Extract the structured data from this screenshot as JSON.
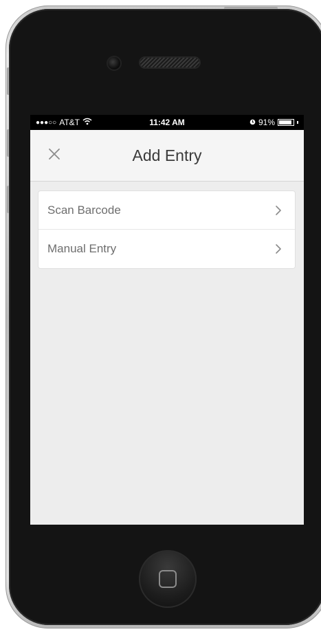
{
  "status_bar": {
    "carrier": "AT&T",
    "time": "11:42 AM",
    "battery": "91%",
    "battery_level": 0.91
  },
  "nav": {
    "title": "Add Entry",
    "close_icon": "close-icon"
  },
  "menu": {
    "items": [
      {
        "label": "Scan Barcode",
        "icon": "chevron-right-icon"
      },
      {
        "label": "Manual Entry",
        "icon": "chevron-right-icon"
      }
    ]
  },
  "colors": {
    "screen_background": "#ededed",
    "nav_background": "#f5f5f5",
    "title_text": "#3a3a3a",
    "item_text": "#6e6e6e"
  }
}
